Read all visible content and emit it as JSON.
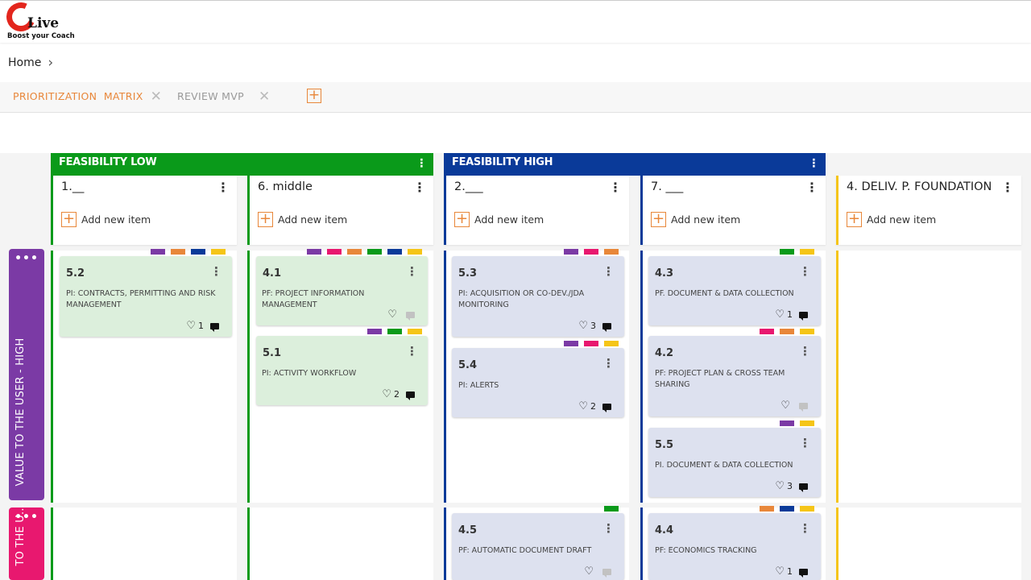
{
  "logo": {
    "text": "Live",
    "tagline": "Boost your Coach"
  },
  "breadcrumb": {
    "home": "Home"
  },
  "tabs": [
    {
      "label": "PRIORITIZATION  MATRIX",
      "active": true
    },
    {
      "label": "REVIEW MVP",
      "active": false
    }
  ],
  "add_tab_symbol": "+",
  "groups": [
    {
      "label": "FEASIBILITY LOW",
      "color": "#0a9a1a"
    },
    {
      "label": "FEASIBILITY HIGH",
      "color": "#0a3a99"
    }
  ],
  "columns": [
    {
      "title": "1.__",
      "add_label": "Add new item",
      "accent": "#0a9a1a"
    },
    {
      "title": "6. middle",
      "add_label": "Add new item",
      "accent": "#0a9a1a"
    },
    {
      "title": "2.___",
      "add_label": "Add new item",
      "accent": "#0a3a99"
    },
    {
      "title": "7. ___",
      "add_label": "Add new item",
      "accent": "#0a3a99"
    },
    {
      "title": "4. DELIV. P. FOUNDATION",
      "add_label": "Add new item",
      "accent": "#f5c518"
    }
  ],
  "rows": [
    {
      "label": "VALUE TO THE USER - HIGH",
      "color": "#7b3aa5"
    },
    {
      "label": "TO THE U...",
      "color": "#e8186f"
    }
  ],
  "tag_colors": {
    "purple": "#7b3aa5",
    "orange": "#e8873a",
    "navy": "#0a3a99",
    "yellow": "#f5c518",
    "pink": "#e8186f",
    "green": "#0a9a1a"
  },
  "cards": {
    "c52": {
      "id": "5.2",
      "desc": "PI: CONTRACTS, PERMITTING AND RISK MANAGEMENT",
      "likes": "1"
    },
    "c41": {
      "id": "4.1",
      "desc": "PF: PROJECT INFORMATION MANAGEMENT",
      "likes": ""
    },
    "c51": {
      "id": "5.1",
      "desc": "PI: ACTIVITY WORKFLOW",
      "likes": "2"
    },
    "c53": {
      "id": "5.3",
      "desc": "PI: ACQUISITION OR CO-DEV./JDA MONITORING",
      "likes": "3"
    },
    "c54": {
      "id": "5.4",
      "desc": "PI: ALERTS",
      "likes": "2"
    },
    "c43": {
      "id": "4.3",
      "desc": "PF. DOCUMENT & DATA COLLECTION",
      "likes": "1"
    },
    "c42": {
      "id": "4.2",
      "desc": "PF: PROJECT PLAN & CROSS TEAM SHARING",
      "likes": ""
    },
    "c55": {
      "id": "5.5",
      "desc": "PI. DOCUMENT & DATA COLLECTION",
      "likes": "3"
    },
    "c45": {
      "id": "4.5",
      "desc": "PF: AUTOMATIC DOCUMENT DRAFT",
      "likes": ""
    },
    "c44": {
      "id": "4.4",
      "desc": "PF: ECONOMICS TRACKING",
      "likes": "1"
    }
  }
}
